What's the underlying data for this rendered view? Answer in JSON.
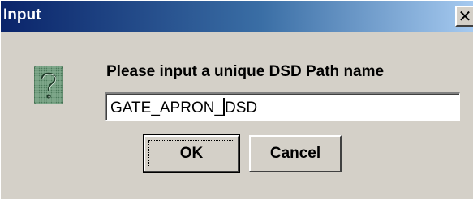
{
  "window": {
    "title": "Input",
    "close_symbol": "✕"
  },
  "icon": {
    "name": "question-icon",
    "color": "#5a8a6a"
  },
  "prompt": {
    "text": "Please input a unique DSD Path name"
  },
  "input": {
    "value_before_caret": "GATE_APRON_",
    "value_after_caret": "DSD"
  },
  "buttons": {
    "ok_label": "OK",
    "cancel_label": "Cancel"
  },
  "colors": {
    "title_start": "#0a246a",
    "title_end": "#a6caf0",
    "face": "#d4d0c8"
  }
}
